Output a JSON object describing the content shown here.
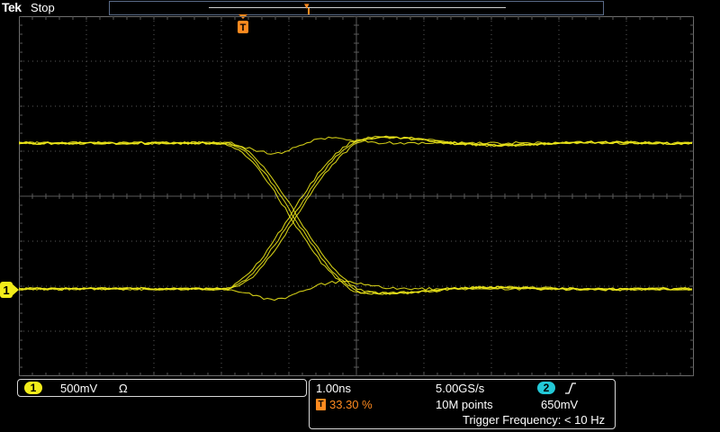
{
  "header": {
    "brand": "Tek",
    "run_state": "Stop"
  },
  "channel1": {
    "badge": "1",
    "scale": "500mV",
    "coupling_symbol": "Ω",
    "color": "#f2ec1a"
  },
  "acquisition": {
    "timebase": "1.00ns",
    "sample_rate": "5.00GS/s",
    "trigger_position_symbol": "T",
    "trigger_position": "33.30 %",
    "record_length": "10M points",
    "trigger_source_badge": "2",
    "trigger_level": "650mV",
    "trigger_frequency": "Trigger Frequency: < 10 Hz",
    "trigger_slope": "rising"
  },
  "markers": {
    "trigger_marker_label": "T",
    "channel_marker_label": "1"
  },
  "colors": {
    "trace": "#f2ec1a",
    "trigger": "#ff8a1f",
    "channel2": "#23c8d6",
    "grid": "#5a5a5a"
  }
}
